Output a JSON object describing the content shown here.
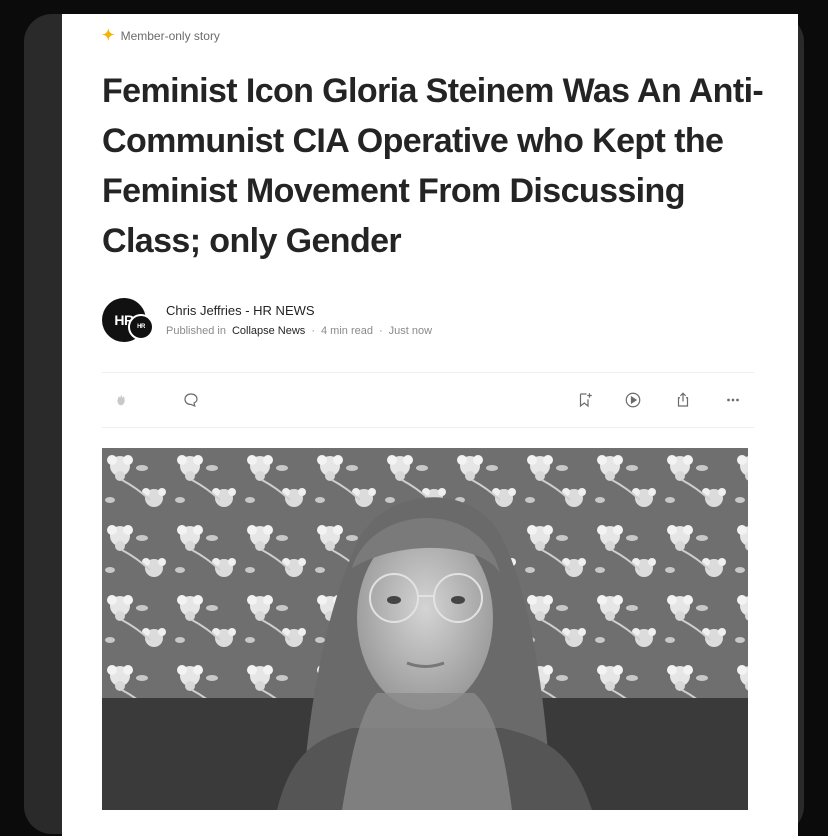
{
  "article": {
    "badge": "Member-only story",
    "title": "Feminist Icon Gloria Steinem Was An Anti-Communist CIA Operative who Kept the Feminist Movement From Discussing Class; only Gender",
    "author": "Chris Jeffries - HR NEWS",
    "published_in_prefix": "Published in",
    "publication": "Collapse News",
    "read_time": "4 min read",
    "posted": "Just now",
    "separator": "·"
  },
  "avatar": {
    "main_text": "HR",
    "sub_text": "HR"
  },
  "icons": {
    "badge": "star-icon",
    "clap": "clap-icon",
    "comment": "comment-icon",
    "bookmark": "bookmark-add-icon",
    "listen": "play-icon",
    "share": "share-icon",
    "more": "more-icon"
  },
  "colors": {
    "badge_star": "#f4b400",
    "title": "#242424",
    "muted": "#6b6b6b"
  }
}
